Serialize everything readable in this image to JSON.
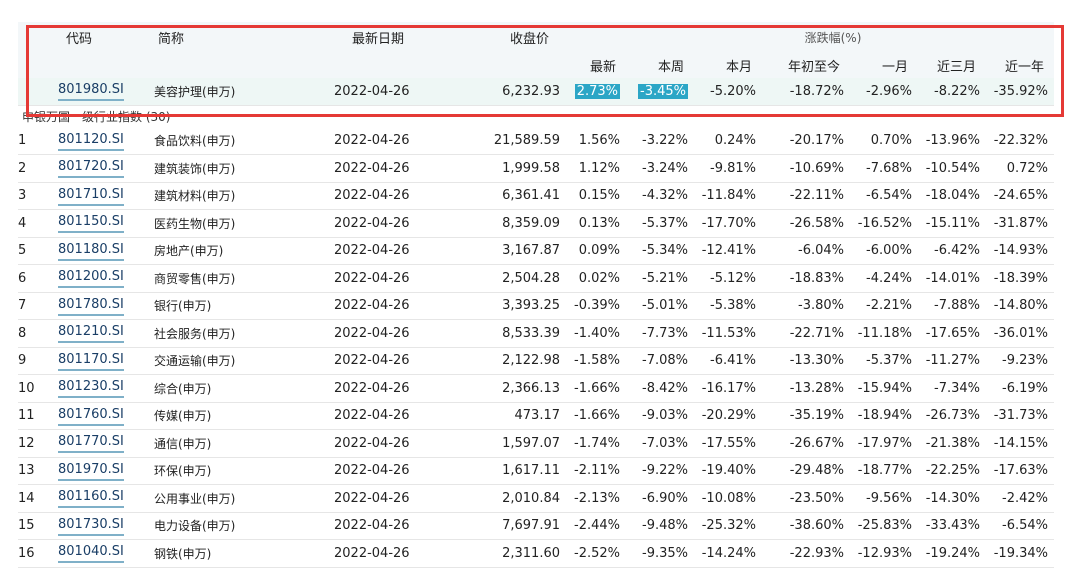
{
  "header": {
    "code": "代码",
    "name": "简称",
    "date": "最新日期",
    "close": "收盘价",
    "change_group": "涨跌幅(%)",
    "latest": "最新",
    "week": "本周",
    "month": "本月",
    "ytd": "年初至今",
    "one_month": "一月",
    "three_months": "近三月",
    "one_year": "近一年"
  },
  "featured": {
    "code": "801980.SI",
    "name": "美容护理(申万)",
    "date": "2022-04-26",
    "close": "6,232.93",
    "latest": "2.73%",
    "week": "-3.45%",
    "month": "-5.20%",
    "ytd": "-18.72%",
    "one_month": "-2.96%",
    "three_months": "-8.22%",
    "one_year": "-35.92%"
  },
  "category_label": "申银万国一级行业指数 (30)",
  "rows": [
    {
      "idx": "1",
      "code": "801120.SI",
      "name": "食品饮料(申万)",
      "date": "2022-04-26",
      "close": "21,589.59",
      "latest": "1.56%",
      "week": "-3.22%",
      "month": "0.24%",
      "ytd": "-20.17%",
      "one_month": "0.70%",
      "three_months": "-13.96%",
      "one_year": "-22.32%"
    },
    {
      "idx": "2",
      "code": "801720.SI",
      "name": "建筑装饰(申万)",
      "date": "2022-04-26",
      "close": "1,999.58",
      "latest": "1.12%",
      "week": "-3.24%",
      "month": "-9.81%",
      "ytd": "-10.69%",
      "one_month": "-7.68%",
      "three_months": "-10.54%",
      "one_year": "0.72%"
    },
    {
      "idx": "3",
      "code": "801710.SI",
      "name": "建筑材料(申万)",
      "date": "2022-04-26",
      "close": "6,361.41",
      "latest": "0.15%",
      "week": "-4.32%",
      "month": "-11.84%",
      "ytd": "-22.11%",
      "one_month": "-6.54%",
      "three_months": "-18.04%",
      "one_year": "-24.65%"
    },
    {
      "idx": "4",
      "code": "801150.SI",
      "name": "医药生物(申万)",
      "date": "2022-04-26",
      "close": "8,359.09",
      "latest": "0.13%",
      "week": "-5.37%",
      "month": "-17.70%",
      "ytd": "-26.58%",
      "one_month": "-16.52%",
      "three_months": "-15.11%",
      "one_year": "-31.87%"
    },
    {
      "idx": "5",
      "code": "801180.SI",
      "name": "房地产(申万)",
      "date": "2022-04-26",
      "close": "3,167.87",
      "latest": "0.09%",
      "week": "-5.34%",
      "month": "-12.41%",
      "ytd": "-6.04%",
      "one_month": "-6.00%",
      "three_months": "-6.42%",
      "one_year": "-14.93%"
    },
    {
      "idx": "6",
      "code": "801200.SI",
      "name": "商贸零售(申万)",
      "date": "2022-04-26",
      "close": "2,504.28",
      "latest": "0.02%",
      "week": "-5.21%",
      "month": "-5.12%",
      "ytd": "-18.83%",
      "one_month": "-4.24%",
      "three_months": "-14.01%",
      "one_year": "-18.39%"
    },
    {
      "idx": "7",
      "code": "801780.SI",
      "name": "银行(申万)",
      "date": "2022-04-26",
      "close": "3,393.25",
      "latest": "-0.39%",
      "week": "-5.01%",
      "month": "-5.38%",
      "ytd": "-3.80%",
      "one_month": "-2.21%",
      "three_months": "-7.88%",
      "one_year": "-14.80%"
    },
    {
      "idx": "8",
      "code": "801210.SI",
      "name": "社会服务(申万)",
      "date": "2022-04-26",
      "close": "8,533.39",
      "latest": "-1.40%",
      "week": "-7.73%",
      "month": "-11.53%",
      "ytd": "-22.71%",
      "one_month": "-11.18%",
      "three_months": "-17.65%",
      "one_year": "-36.01%"
    },
    {
      "idx": "9",
      "code": "801170.SI",
      "name": "交通运输(申万)",
      "date": "2022-04-26",
      "close": "2,122.98",
      "latest": "-1.58%",
      "week": "-7.08%",
      "month": "-6.41%",
      "ytd": "-13.30%",
      "one_month": "-5.37%",
      "three_months": "-11.27%",
      "one_year": "-9.23%"
    },
    {
      "idx": "10",
      "code": "801230.SI",
      "name": "综合(申万)",
      "date": "2022-04-26",
      "close": "2,366.13",
      "latest": "-1.66%",
      "week": "-8.42%",
      "month": "-16.17%",
      "ytd": "-13.28%",
      "one_month": "-15.94%",
      "three_months": "-7.34%",
      "one_year": "-6.19%"
    },
    {
      "idx": "11",
      "code": "801760.SI",
      "name": "传媒(申万)",
      "date": "2022-04-26",
      "close": "473.17",
      "latest": "-1.66%",
      "week": "-9.03%",
      "month": "-20.29%",
      "ytd": "-35.19%",
      "one_month": "-18.94%",
      "three_months": "-26.73%",
      "one_year": "-31.73%"
    },
    {
      "idx": "12",
      "code": "801770.SI",
      "name": "通信(申万)",
      "date": "2022-04-26",
      "close": "1,597.07",
      "latest": "-1.74%",
      "week": "-7.03%",
      "month": "-17.55%",
      "ytd": "-26.67%",
      "one_month": "-17.97%",
      "three_months": "-21.38%",
      "one_year": "-14.15%"
    },
    {
      "idx": "13",
      "code": "801970.SI",
      "name": "环保(申万)",
      "date": "2022-04-26",
      "close": "1,617.11",
      "latest": "-2.11%",
      "week": "-9.22%",
      "month": "-19.40%",
      "ytd": "-29.48%",
      "one_month": "-18.77%",
      "three_months": "-22.25%",
      "one_year": "-17.63%"
    },
    {
      "idx": "14",
      "code": "801160.SI",
      "name": "公用事业(申万)",
      "date": "2022-04-26",
      "close": "2,010.84",
      "latest": "-2.13%",
      "week": "-6.90%",
      "month": "-10.08%",
      "ytd": "-23.50%",
      "one_month": "-9.56%",
      "three_months": "-14.30%",
      "one_year": "-2.42%"
    },
    {
      "idx": "15",
      "code": "801730.SI",
      "name": "电力设备(申万)",
      "date": "2022-04-26",
      "close": "7,697.91",
      "latest": "-2.44%",
      "week": "-9.48%",
      "month": "-25.32%",
      "ytd": "-38.60%",
      "one_month": "-25.83%",
      "three_months": "-33.43%",
      "one_year": "-6.54%"
    },
    {
      "idx": "16",
      "code": "801040.SI",
      "name": "钢铁(申万)",
      "date": "2022-04-26",
      "close": "2,311.60",
      "latest": "-2.52%",
      "week": "-9.35%",
      "month": "-14.24%",
      "ytd": "-22.93%",
      "one_month": "-12.93%",
      "three_months": "-19.24%",
      "one_year": "-19.34%"
    }
  ],
  "colors": {
    "highlight": "#2ba6c6",
    "box": "#e53935",
    "code_underline": "#7fb0c8"
  }
}
